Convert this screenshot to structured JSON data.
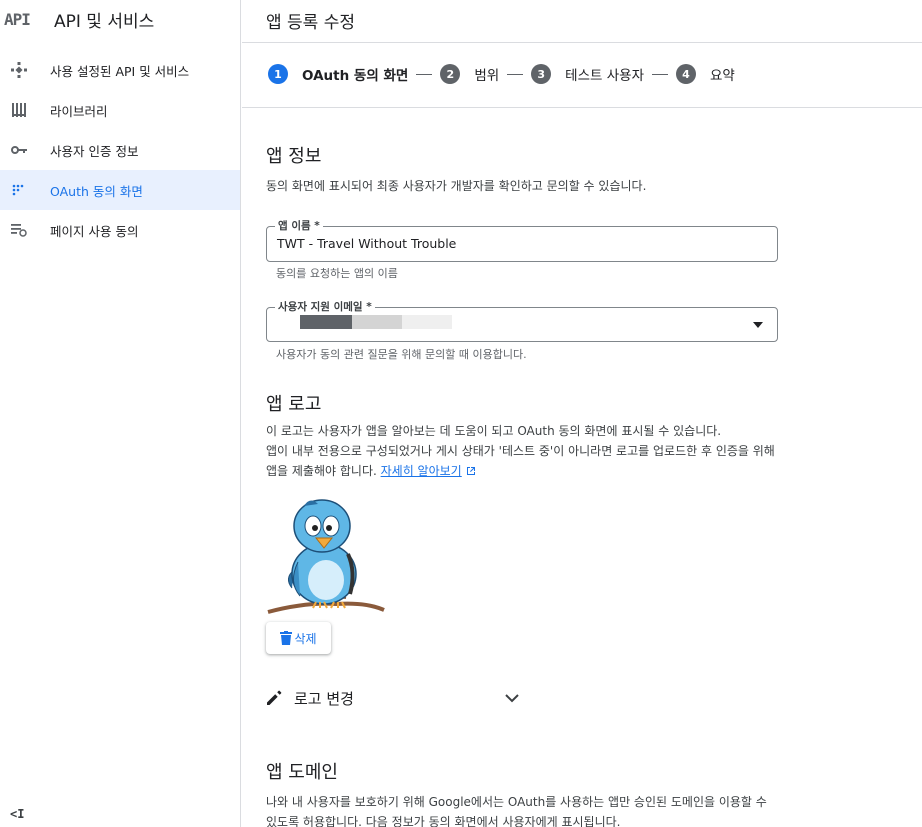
{
  "sidebar": {
    "logo": "API",
    "title": "API 및 서비스",
    "items": [
      {
        "label": "사용 설정된 API 및 서비스",
        "icon": "api-services-icon"
      },
      {
        "label": "라이브러리",
        "icon": "library-icon"
      },
      {
        "label": "사용자 인증 정보",
        "icon": "key-icon"
      },
      {
        "label": "OAuth 동의 화면",
        "icon": "consent-screen-icon",
        "active": true
      },
      {
        "label": "페이지 사용 동의",
        "icon": "page-usage-agreement-icon"
      }
    ],
    "collapse_label": "<I"
  },
  "header": {
    "title": "앱 등록 수정"
  },
  "stepper": {
    "steps": [
      {
        "num": "1",
        "label": "OAuth 동의 화면",
        "current": true
      },
      {
        "num": "2",
        "label": "범위"
      },
      {
        "num": "3",
        "label": "테스트 사용자"
      },
      {
        "num": "4",
        "label": "요약"
      }
    ]
  },
  "app_info": {
    "heading": "앱 정보",
    "description": "동의 화면에 표시되어 최종 사용자가 개발자를 확인하고 문의할 수 있습니다.",
    "app_name": {
      "label": "앱 이름 *",
      "value": "TWT - Travel Without Trouble",
      "helper": "동의를 요청하는 앱의 이름"
    },
    "support_email": {
      "label": "사용자 지원 이메일 *",
      "value": "",
      "helper": "사용자가 동의 관련 질문을 위해 문의할 때 이용합니다."
    }
  },
  "app_logo": {
    "heading": "앱 로고",
    "line1": "이 로고는 사용자가 앱을 알아보는 데 도움이 되고 OAuth 동의 화면에 표시될 수 있습니다.",
    "line2": "앱이 내부 전용으로 구성되었거나 게시 상태가 '테스트 중'이 아니라면 로고를 업로드한 후 인증을 위해",
    "line3": "앱을 제출해야 합니다. ",
    "learn_more": "자세히 알아보기",
    "delete_label": "삭제",
    "change_label": "로고 변경"
  },
  "app_domain": {
    "heading": "앱 도메인",
    "line1": "나와 내 사용자를 보호하기 위해 Google에서는 OAuth를 사용하는 앱만 승인된 도메인을 이용할 수",
    "line2": "있도록 허용합니다. 다음 정보가 동의 화면에서 사용자에게 표시됩니다."
  },
  "colors": {
    "accent": "#1a73e8",
    "active_bg": "#e8f0fe",
    "step_inactive": "#5f6368",
    "divider": "#dadce0"
  }
}
